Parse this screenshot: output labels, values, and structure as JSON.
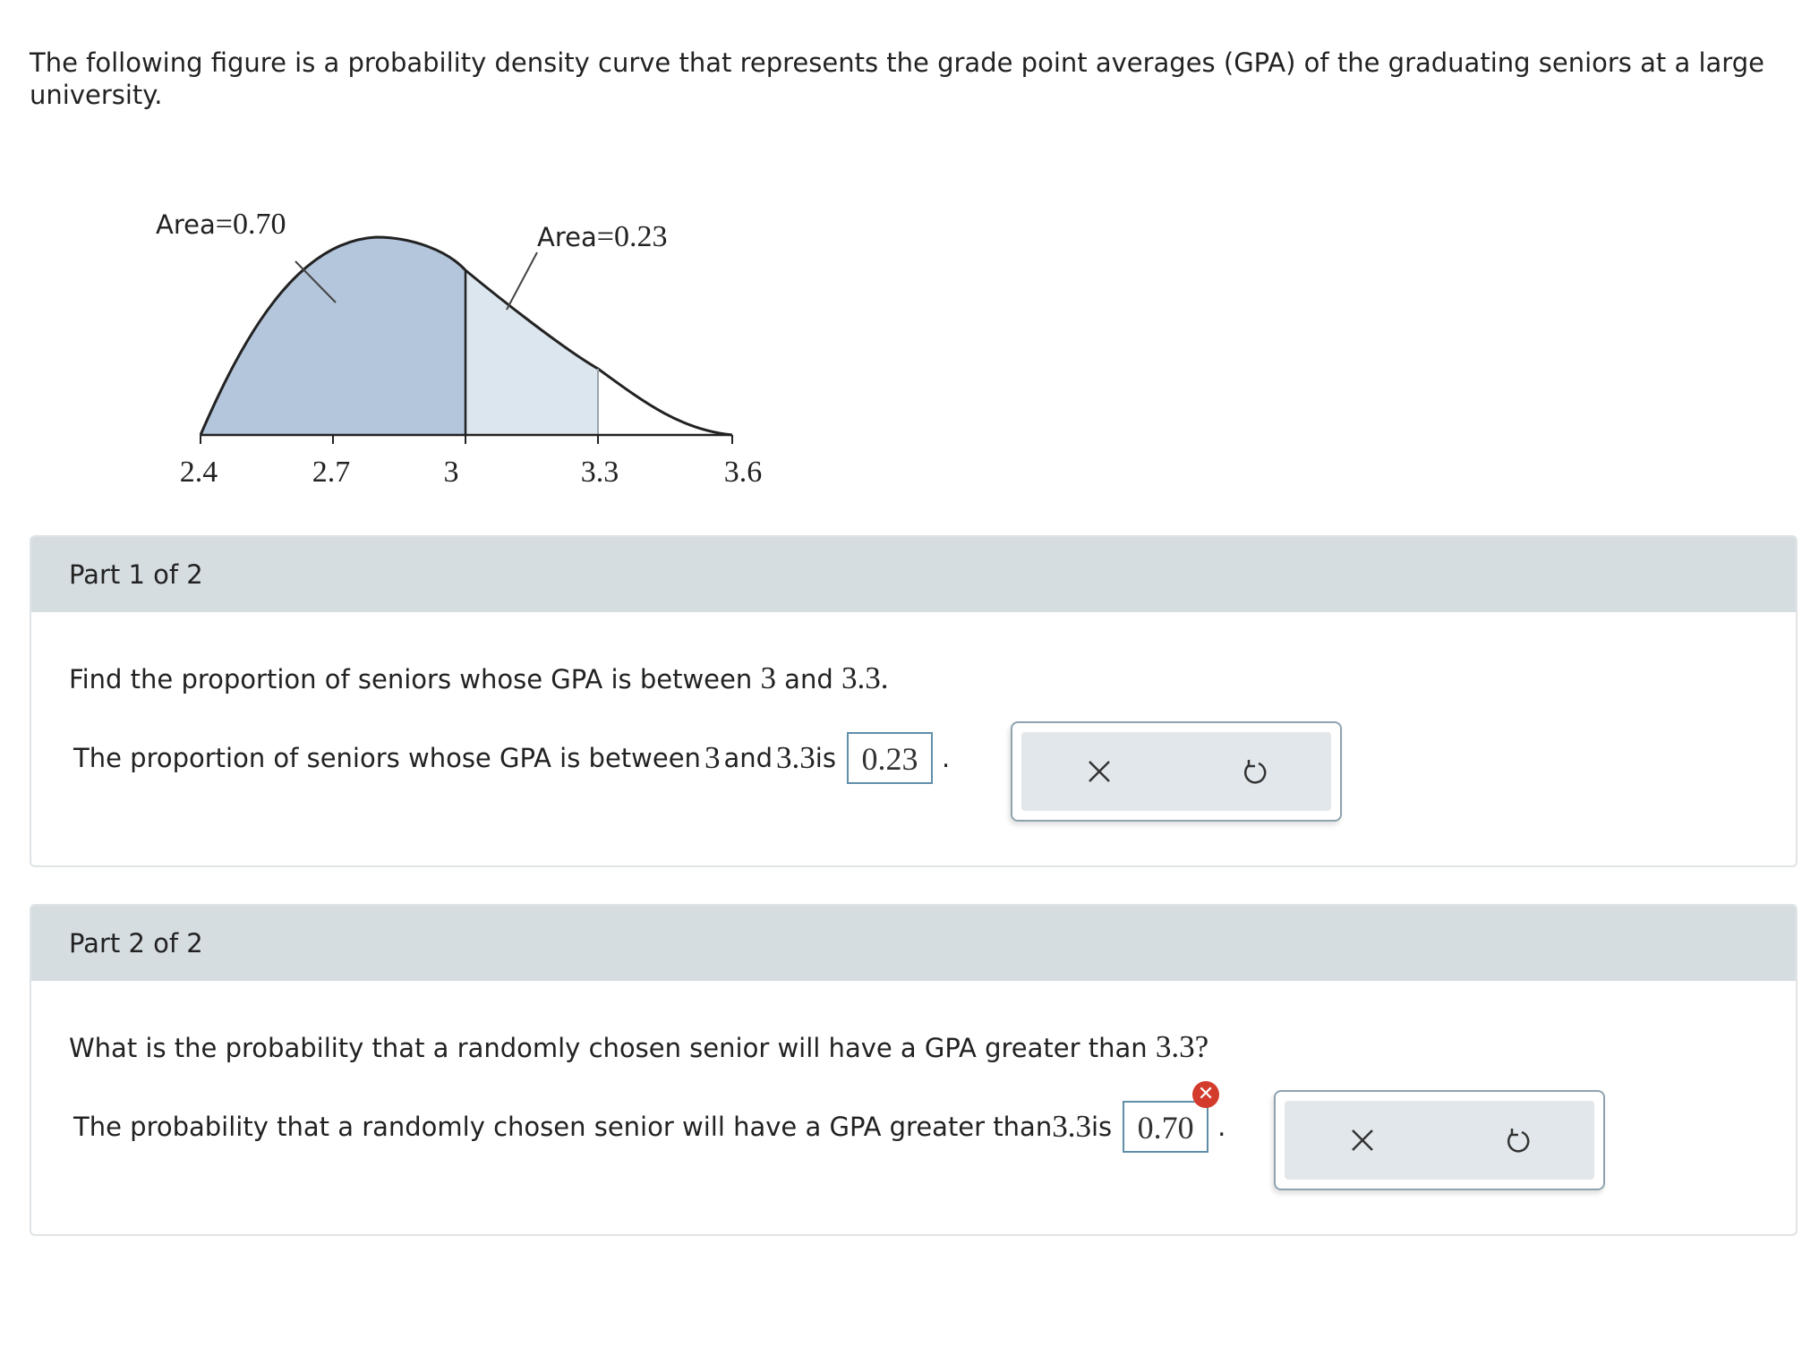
{
  "intro": "The following figure is a probability density curve that represents the grade point averages (GPA) of the graduating seniors at a large university.",
  "figure": {
    "area_left_label": "Area",
    "area_left_eq": "=",
    "area_left_value": "0.70",
    "area_mid_label": "Area",
    "area_mid_eq": "=",
    "area_mid_value": "0.23",
    "ticks": [
      "2.4",
      "2.7",
      "3",
      "3.3",
      "3.6"
    ],
    "colors": {
      "shade_dark": "#b3c6dc",
      "shade_light": "#dce6ee",
      "curve": "#222222"
    }
  },
  "part1": {
    "header": "Part 1 of 2",
    "question_pre": "Find the proportion of seniors whose GPA is between ",
    "q_num1": "3",
    "q_and": " and ",
    "q_num2": "3.3",
    "q_end": ".",
    "answer_pre": "The proportion of seniors whose GPA is between ",
    "a_num1": "3",
    "a_and": " and ",
    "a_num2": "3.3",
    "a_is": " is",
    "answer_value": "0.23",
    "period": "."
  },
  "part2": {
    "header": "Part 2 of 2",
    "question_pre": "What is the probability that a randomly chosen senior will have a GPA greater than ",
    "q_num": "3.3",
    "q_end": "?",
    "answer_pre": "The probability that a randomly chosen senior will have a GPA greater than ",
    "a_num": "3.3",
    "a_is": " is",
    "answer_value": "0.70",
    "period": ".",
    "error_mark": "✕"
  },
  "icons": {
    "clear": "close-icon",
    "undo": "undo-icon",
    "error": "error-icon"
  }
}
